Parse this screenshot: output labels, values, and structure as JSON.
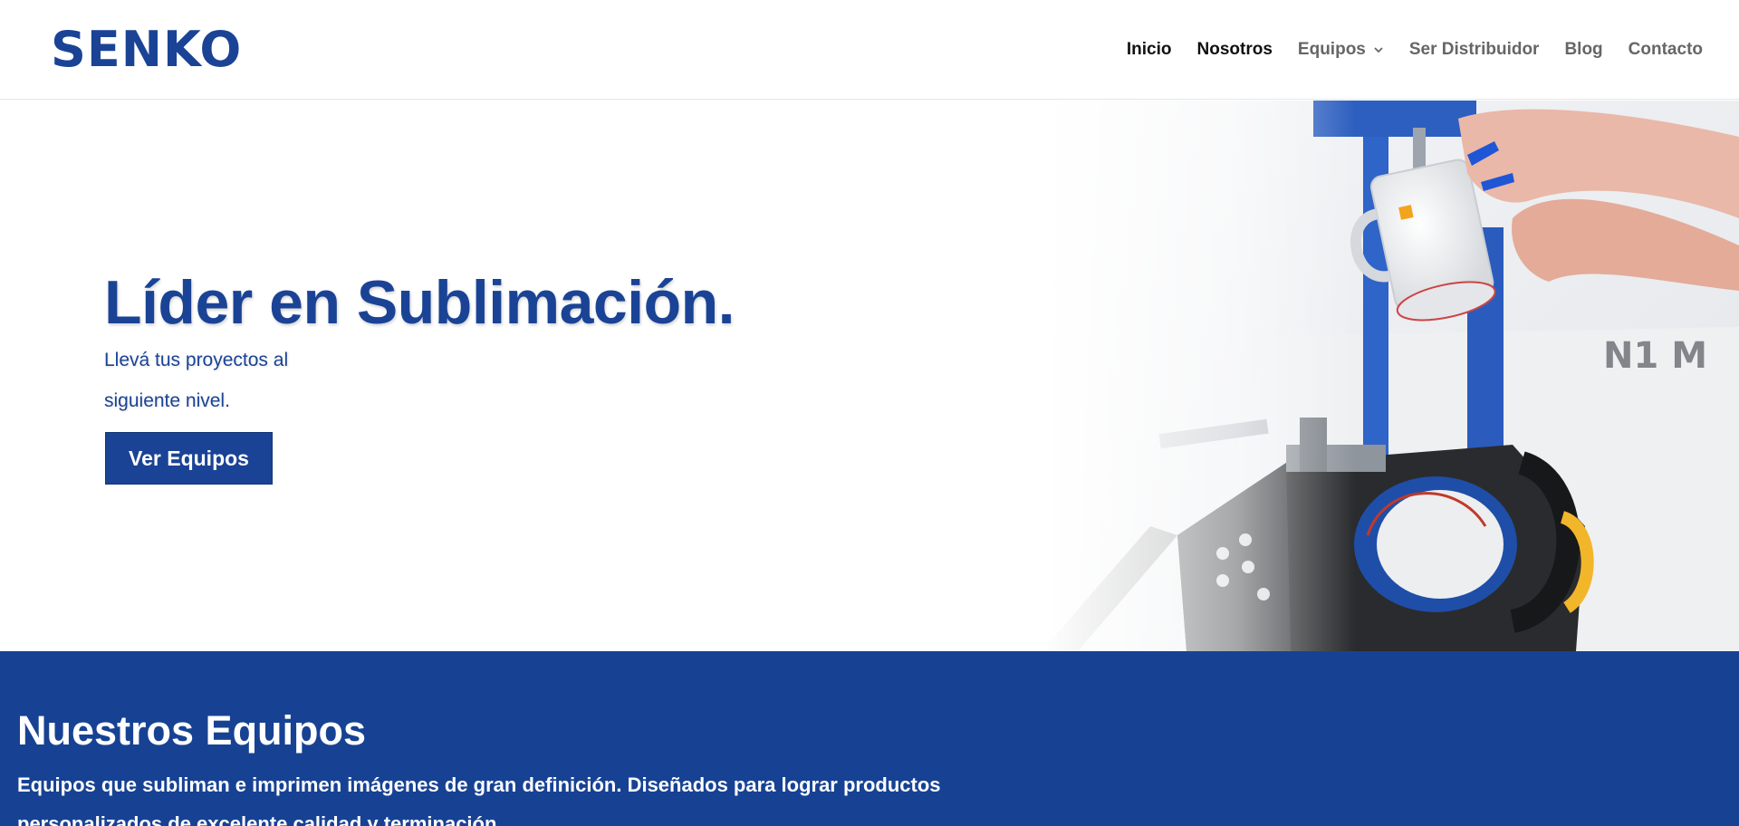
{
  "header": {
    "logo_text": "SENKO",
    "nav": [
      {
        "label": "Inicio",
        "active": true
      },
      {
        "label": "Nosotros",
        "active": true
      },
      {
        "label": "Equipos",
        "has_dropdown": true
      },
      {
        "label": "Ser Distribuidor"
      },
      {
        "label": "Blog"
      },
      {
        "label": "Contacto"
      }
    ]
  },
  "hero": {
    "title": "Líder en Sublimación.",
    "subtitle": "Llevá tus proyectos al siguiente nivel.",
    "button_label": "Ver Equipos",
    "image_icon": "mug-press-photo"
  },
  "equipment": {
    "title": "Nuestros Equipos",
    "description": "Equipos que subliman e imprimen imágenes de gran definición. Diseñados para lograr productos personalizados de excelente calidad y terminación."
  },
  "colors": {
    "brand_blue": "#1a4396",
    "section_blue": "#174294",
    "nav_active": "#111111",
    "nav_inactive": "#666666"
  }
}
